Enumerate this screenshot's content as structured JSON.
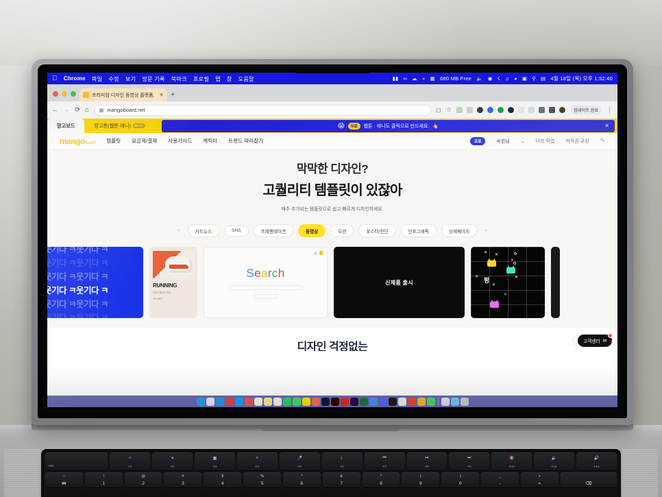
{
  "menubar": {
    "apple": "",
    "app_name": "Chrome",
    "items": [
      "파일",
      "수정",
      "보기",
      "방문 기록",
      "북마크",
      "프로필",
      "탭",
      "창",
      "도움말"
    ],
    "status_memory": "680 MB Free",
    "clock": "4월 18일 (목) 오후 1:52:40",
    "icons": [
      "battery-icon",
      "glasses-icon",
      "cloud-icon",
      "record-icon",
      "memory-icon",
      "volume-mute-icon",
      "control-center-icon",
      "bluetooth-icon",
      "audio-icon",
      "wifi-icon",
      "input-source-icon",
      "spotlight-search-icon",
      "display-icon"
    ]
  },
  "browser": {
    "tab_title": "프리미엄 디자인 동영상 플랫폼, 디…",
    "tab_close": "✕",
    "new_tab": "+",
    "back": "←",
    "forward": "→",
    "reload": "⟳",
    "home": "⌂",
    "url": "mangoboard.net",
    "update_pill": "업데이트 완료",
    "kebab": "⋮",
    "bookmark_star": "☆",
    "share_icon": "share-icon"
  },
  "site": {
    "tabs": [
      {
        "label": "망고보드",
        "active": true,
        "badge": ""
      },
      {
        "label": "망고툰(웹툰·애니)",
        "active": false,
        "badge": "BETA"
      }
    ],
    "promo": {
      "emoji": "😱",
      "badge": "무료",
      "text": "웹툰 · 애니도 클릭으로 만드세요.",
      "hand": "👆",
      "close": "✕"
    },
    "logo": "mango",
    "logo_sub": "board",
    "nav": [
      "템플릿",
      "요금제/결제",
      "사용가이드",
      "캐릭터",
      "트렌드 따라잡기"
    ],
    "account": {
      "plan_badge": "프로",
      "user": "씨원님",
      "chevron": "⌄",
      "my_work": "나의 작업",
      "copyright": "저작권 규정",
      "icon": "pen-icon"
    },
    "hero": {
      "line1": "막막한 디자인?",
      "line2": "고퀄리티 템플릿이 있잖아",
      "sub": "매주 추가되는 템플릿으로 쉽고 빠르게 디자인하세요."
    },
    "chips": {
      "prev": "‹",
      "next": "›",
      "items": [
        {
          "label": "카드뉴스",
          "active": false
        },
        {
          "label": "SNS",
          "active": false
        },
        {
          "label": "프레젠테이션",
          "active": false
        },
        {
          "label": "동영상",
          "active": true
        },
        {
          "label": "모션",
          "active": false
        },
        {
          "label": "포스터/전단",
          "active": false
        },
        {
          "label": "인포그래픽",
          "active": false
        },
        {
          "label": "상세페이지",
          "active": false
        }
      ]
    },
    "cards": [
      {
        "name": "kwoogida-card",
        "lines": [
          "ㅋ웃기다 ㅋ웃기다 ㅋ",
          "ㅋ웃기다 ㅋ웃기다 ㅋ",
          "ㅋ웃기다 ㅋ웃기다 ㅋ",
          "ㅋ웃기다 ㅋ웃기다 ㅋ",
          "ㅋ웃기다 ㅋ웃기다 ㅋ",
          "ㅋ웃기다 ㅋ웃기다 ㅋ"
        ]
      },
      {
        "name": "running-card",
        "title": "RUNNING",
        "sub1": "2024 새로운 런닝",
        "sub2": "TR 0005"
      },
      {
        "name": "search-card",
        "word": "Search",
        "letters": [
          "S",
          "e",
          "a",
          "r",
          "c",
          "h"
        ]
      },
      {
        "name": "new-product-card",
        "text": "신제품 출시"
      },
      {
        "name": "retro-game-card",
        "text": "펑"
      }
    ],
    "bottom_heading": "디자인 걱정없는",
    "scroll_top": "⌃",
    "customer_center": "고객센터",
    "customer_center_icon": "chat-icon"
  },
  "keyboard": {
    "fn_row": [
      {
        "label": "esc",
        "glyph": "",
        "name": "esc-key"
      },
      {
        "label": "F1",
        "glyph": "☼",
        "name": "brightness-down-key"
      },
      {
        "label": "F2",
        "glyph": "☀",
        "name": "brightness-up-key"
      },
      {
        "label": "F3",
        "glyph": "▦",
        "name": "mission-control-key"
      },
      {
        "label": "F4",
        "glyph": "⌕",
        "name": "spotlight-key"
      },
      {
        "label": "F5",
        "glyph": "🎤",
        "name": "dictation-key"
      },
      {
        "label": "F6",
        "glyph": "☾",
        "name": "do-not-disturb-key"
      },
      {
        "label": "F7",
        "glyph": "⏮",
        "name": "previous-track-key"
      },
      {
        "label": "F8",
        "glyph": "⏯",
        "name": "play-pause-key"
      },
      {
        "label": "F9",
        "glyph": "⏭",
        "name": "next-track-key"
      },
      {
        "label": "F10",
        "glyph": "🔇",
        "name": "mute-key"
      },
      {
        "label": "F11",
        "glyph": "🔉",
        "name": "volume-down-key"
      },
      {
        "label": "F12",
        "glyph": "🔊",
        "name": "volume-up-key"
      }
    ],
    "num_row": [
      {
        "upper": "~",
        "lower": "₩",
        "name": "tilde-key"
      },
      {
        "upper": "!",
        "lower": "1",
        "name": "one-key"
      },
      {
        "upper": "@",
        "lower": "2",
        "name": "two-key"
      },
      {
        "upper": "#",
        "lower": "3",
        "name": "three-key"
      },
      {
        "upper": "$",
        "lower": "4",
        "name": "four-key"
      },
      {
        "upper": "%",
        "lower": "5",
        "name": "five-key"
      },
      {
        "upper": "^",
        "lower": "6",
        "name": "six-key"
      },
      {
        "upper": "&",
        "lower": "7",
        "name": "seven-key"
      },
      {
        "upper": "*",
        "lower": "8",
        "name": "eight-key"
      },
      {
        "upper": "(",
        "lower": "9",
        "name": "nine-key"
      },
      {
        "upper": ")",
        "lower": "0",
        "name": "zero-key"
      },
      {
        "upper": "_",
        "lower": "-",
        "name": "minus-key"
      },
      {
        "upper": "+",
        "lower": "=",
        "name": "equals-key"
      },
      {
        "upper": "",
        "lower": "⌫",
        "name": "delete-key"
      }
    ]
  },
  "dock": {
    "icons": [
      "finder-icon",
      "launchpad-icon",
      "safari-icon",
      "chrome-icon",
      "twitter-icon",
      "photos-icon",
      "notes-icon",
      "stickies-icon",
      "notion-icon",
      "whatsapp-icon",
      "messages-icon",
      "kakaotalk-icon",
      "calendar-icon",
      "photoshop-icon",
      "illustrator-icon",
      "acrobat-icon",
      "indesign-icon",
      "excel-icon",
      "drive-icon",
      "discord-icon",
      "terminal-icon",
      "mail-icon",
      "slack-icon",
      "lightning-icon",
      "facetime-icon",
      "airdrop-icon",
      "folder-icon",
      "trash-icon"
    ]
  },
  "colors": {
    "menubar_blue": "#1718e0",
    "brand_yellow": "#ffd900",
    "promo_blue": "#2222d8",
    "chip_active": "#ffe02e",
    "pro_badge": "#2c36d8"
  }
}
